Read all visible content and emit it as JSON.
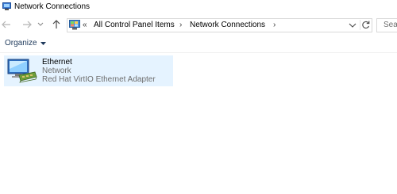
{
  "window": {
    "title": "Network Connections",
    "title_icon": "network-connections-icon"
  },
  "navigation": {
    "back_icon": "arrow-left-icon",
    "forward_icon": "arrow-right-icon",
    "recent_icon": "chevron-down-icon",
    "up_icon": "arrow-up-icon"
  },
  "address": {
    "location_icon": "control-panel-icon",
    "overflow": "«",
    "breadcrumbs": [
      {
        "label": "All Control Panel Items"
      },
      {
        "label": "Network Connections"
      }
    ],
    "separator": "›",
    "dropdown_icon": "chevron-down-icon",
    "refresh_icon": "refresh-icon"
  },
  "search": {
    "placeholder": "Sea"
  },
  "toolbar": {
    "organize_label": "Organize",
    "organize_caret_icon": "caret-down-icon"
  },
  "connections": [
    {
      "name": "Ethernet",
      "network": "Network",
      "adapter": "Red Hat VirtIO Ethernet Adapter",
      "icon": "ethernet-adapter-icon",
      "selected": true
    }
  ],
  "colors": {
    "selection_background": "#e5f3ff",
    "organize_text": "#1e395b",
    "secondary_text": "#6d6d6d"
  }
}
